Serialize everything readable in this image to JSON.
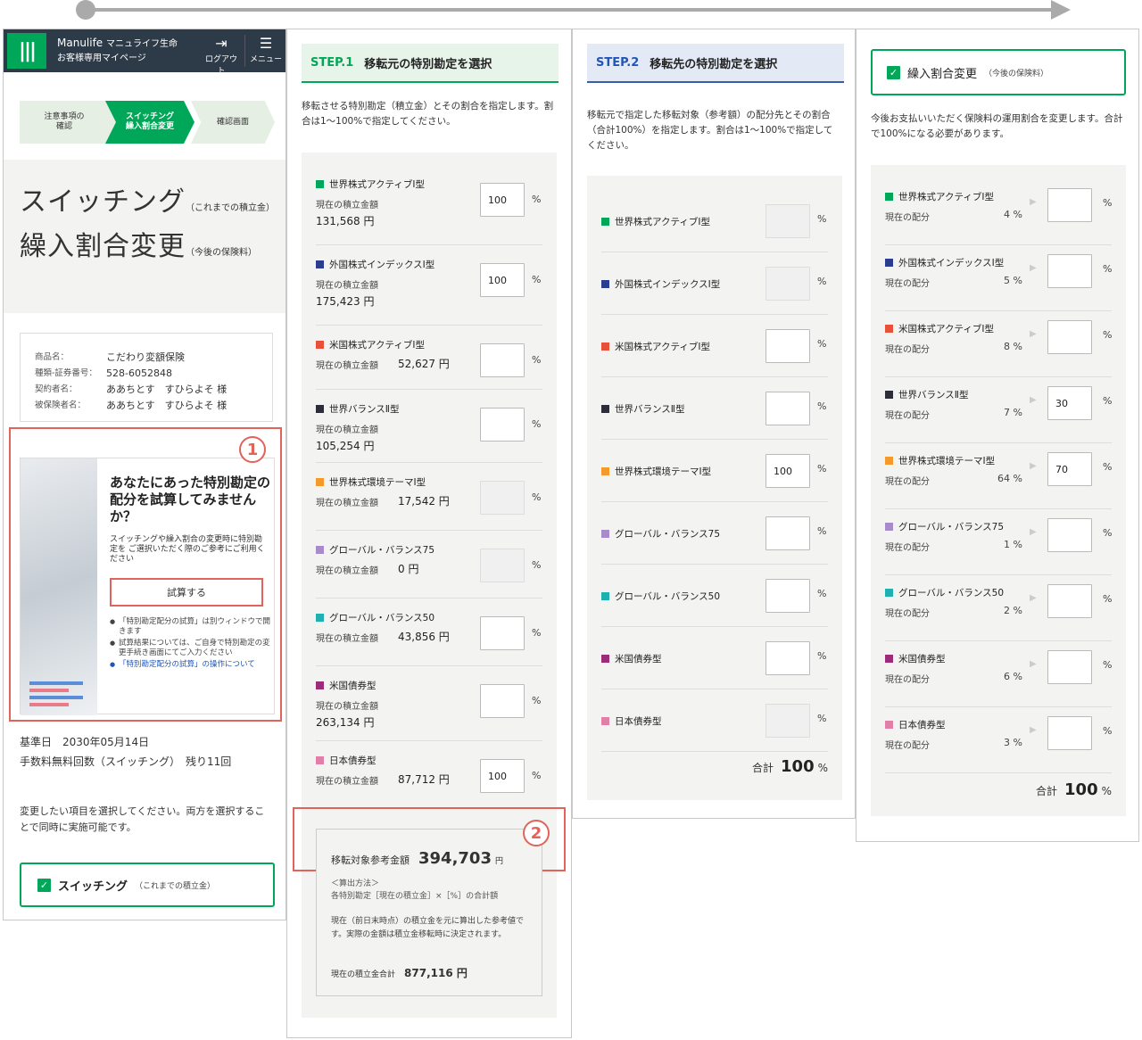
{
  "header": {
    "brand": "Manulife",
    "brand_jp": "マニュライフ生命",
    "subtitle": "お客様専用マイページ",
    "logout": "ログアウト",
    "menu": "メニュー"
  },
  "steps": [
    "注意事項の\n確認",
    "スイッチング\n繰入割合変更",
    "確認画面"
  ],
  "title1": "スイッチング",
  "title1_note": "（これまでの積立金）",
  "title2": "繰入割合変更",
  "title2_note": "（今後の保険料）",
  "policy": [
    {
      "k": "商品名：",
      "v": "こだわり変額保険"
    },
    {
      "k": "種類-証券番号：",
      "v": "528-6052848"
    },
    {
      "k": "契約者名：",
      "v": "ああちとす　すひらよそ 様"
    },
    {
      "k": "被保険者名：",
      "v": "ああちとす　すひらよそ 様"
    }
  ],
  "callouts": {
    "one": "1",
    "two": "2"
  },
  "promo": {
    "title": "あなたにあった特別勘定の配分を試算してみませんか？",
    "text": "スイッチングや繰入割合の変更時に特別勘定を ご選択いただく際のご参考にご利用ください",
    "button": "試算する",
    "notes": [
      "「特別勘定配分の試算」は別ウィンドウで開きます",
      "試算結果については、ご自身で特別勘定の変更手続き画面にてご入力ください"
    ],
    "link": "「特別勘定配分の試算」の操作について"
  },
  "base_date": "基準日　2030年05月14日",
  "free_count": "手数料無料回数（スイッチング）　残り11回",
  "instruction": "変更したい項目を選択してください。両方を選択することで同時に実施可能です。",
  "switching_check": {
    "label": "スイッチング",
    "note": "（これまでの積立金）"
  },
  "step1": {
    "num": "STEP.1",
    "title": "移転元の特別勘定を選択",
    "desc": "移転させる特別勘定（積立金）とその割合を指定します。割合は1〜100%で指定してください。",
    "amount_label": "現在の積立金額",
    "funds": [
      {
        "name": "世界株式アクティブⅠ型",
        "color": "#00a758",
        "amount": "131,568 円",
        "value": "100",
        "disabled": false
      },
      {
        "name": "外国株式インデックスⅠ型",
        "color": "#2a3d8f",
        "amount": "175,423 円",
        "value": "100",
        "disabled": false
      },
      {
        "name": "米国株式アクティブⅠ型",
        "color": "#e8503a",
        "amount": "52,627 円",
        "value": "",
        "disabled": false
      },
      {
        "name": "世界バランスⅡ型",
        "color": "#2d2d3a",
        "amount": "105,254 円",
        "value": "",
        "disabled": false
      },
      {
        "name": "世界株式環境テーマⅠ型",
        "color": "#f39a2b",
        "amount": "17,542 円",
        "value": "",
        "disabled": true
      },
      {
        "name": "グローバル・バランス75",
        "color": "#a78bcb",
        "amount": "0 円",
        "value": "",
        "disabled": true
      },
      {
        "name": "グローバル・バランス50",
        "color": "#1fb0b0",
        "amount": "43,856 円",
        "value": "",
        "disabled": false
      },
      {
        "name": "米国債券型",
        "color": "#9c2b7a",
        "amount": "263,134 円",
        "value": "",
        "disabled": false
      },
      {
        "name": "日本債券型",
        "color": "#e17fa8",
        "amount": "87,712 円",
        "value": "100",
        "disabled": false
      }
    ],
    "pct": "%",
    "transfer_label": "移転対象参考金額",
    "transfer_value": "394,703",
    "yen": "円",
    "method": "＜算出方法＞\n各特別勘定［現在の積立金］×［%］の合計額",
    "note": "現在（前日末時点）の積立金を元に算出した参考値です。実際の金額は積立金移転時に決定されます。",
    "total_label": "現在の積立金合計",
    "total_value": "877,116 円"
  },
  "step2": {
    "num": "STEP.2",
    "title": "移転先の特別勘定を選択",
    "desc": "移転元で指定した移転対象（参考額）の配分先とその割合（合計100%）を指定します。割合は1〜100%で指定してください。",
    "funds": [
      {
        "name": "世界株式アクティブⅠ型",
        "color": "#00a758",
        "value": "",
        "disabled": true
      },
      {
        "name": "外国株式インデックスⅠ型",
        "color": "#2a3d8f",
        "value": "",
        "disabled": true
      },
      {
        "name": "米国株式アクティブⅠ型",
        "color": "#e8503a",
        "value": "",
        "disabled": false
      },
      {
        "name": "世界バランスⅡ型",
        "color": "#2d2d3a",
        "value": "",
        "disabled": false
      },
      {
        "name": "世界株式環境テーマⅠ型",
        "color": "#f39a2b",
        "value": "100",
        "disabled": false
      },
      {
        "name": "グローバル・バランス75",
        "color": "#a78bcb",
        "value": "",
        "disabled": false
      },
      {
        "name": "グローバル・バランス50",
        "color": "#1fb0b0",
        "value": "",
        "disabled": false
      },
      {
        "name": "米国債券型",
        "color": "#9c2b7a",
        "value": "",
        "disabled": false
      },
      {
        "name": "日本債券型",
        "color": "#e17fa8",
        "value": "",
        "disabled": true
      }
    ],
    "total_label": "合計",
    "total_value": "100",
    "pct": "%"
  },
  "step3": {
    "check_label": "繰入割合変更",
    "check_note": "（今後の保険料）",
    "desc": "今後お支払いいただく保険料の運用割合を変更します。合計で100%になる必要があります。",
    "alloc_label": "現在の配分",
    "funds": [
      {
        "name": "世界株式アクティブⅠ型",
        "color": "#00a758",
        "current": "4 %",
        "value": ""
      },
      {
        "name": "外国株式インデックスⅠ型",
        "color": "#2a3d8f",
        "current": "5 %",
        "value": ""
      },
      {
        "name": "米国株式アクティブⅠ型",
        "color": "#e8503a",
        "current": "8 %",
        "value": ""
      },
      {
        "name": "世界バランスⅡ型",
        "color": "#2d2d3a",
        "current": "7 %",
        "value": "30"
      },
      {
        "name": "世界株式環境テーマⅠ型",
        "color": "#f39a2b",
        "current": "64 %",
        "value": "70"
      },
      {
        "name": "グローバル・バランス75",
        "color": "#a78bcb",
        "current": "1 %",
        "value": ""
      },
      {
        "name": "グローバル・バランス50",
        "color": "#1fb0b0",
        "current": "2 %",
        "value": ""
      },
      {
        "name": "米国債券型",
        "color": "#9c2b7a",
        "current": "6 %",
        "value": ""
      },
      {
        "name": "日本債券型",
        "color": "#e17fa8",
        "current": "3 %",
        "value": ""
      }
    ],
    "total_label": "合計",
    "total_value": "100",
    "pct": "%"
  }
}
